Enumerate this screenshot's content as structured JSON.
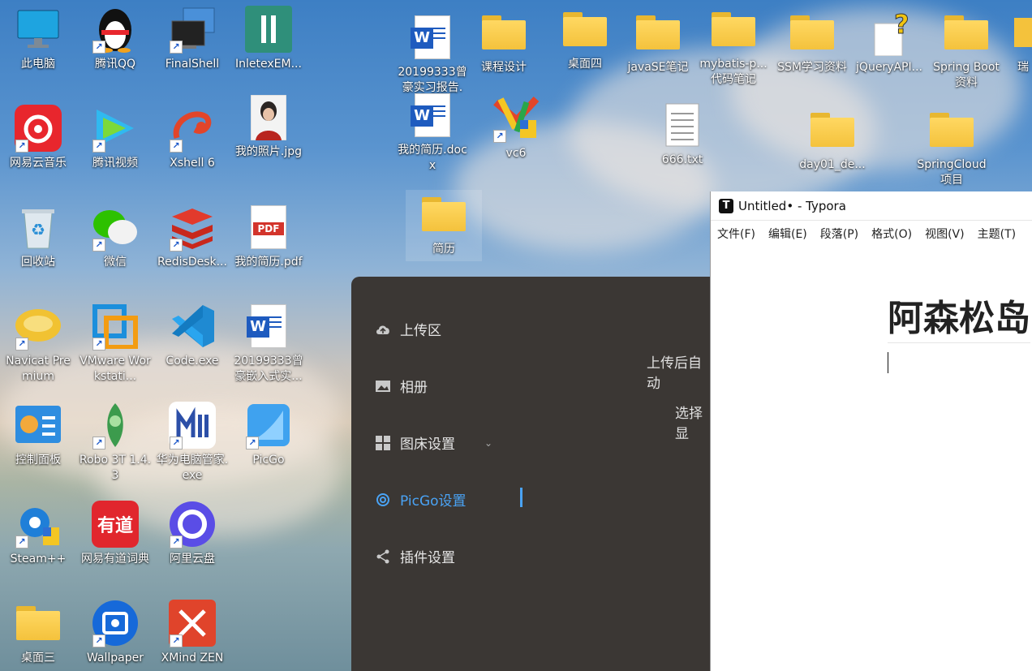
{
  "desktop": {
    "icons": {
      "this_pc": "此电脑",
      "tencent_qq": "腾讯QQ",
      "finalshell": "FinalShell",
      "inletex": "InletexEM...",
      "report_docx": "20199333曾豪实习报告.",
      "course_design": "课程设计",
      "desktop4": "桌面四",
      "javase_notes": "javaSE笔记",
      "mybatis_notes": "mybatis-p... 代码笔记",
      "ssm_notes": "SSM学习资料",
      "jquery_api": "jQueryAPI...",
      "springboot": "Spring Boot 资料",
      "rui": "瑞",
      "netease_music": "网易云音乐",
      "tencent_video": "腾讯视频",
      "xshell": "Xshell 6",
      "my_photo": "我的照片.jpg",
      "my_resume_docx": "我的简历.docx",
      "vc6": "vc6",
      "txt_666": "666.txt",
      "day01": "day01_de...",
      "springcloud": "SpringCloud 项目",
      "recycle_bin": "回收站",
      "wechat": "微信",
      "redis_desk": "RedisDesk...",
      "my_resume_pdf": "我的简历.pdf",
      "resume_folder": "简历",
      "navicat": "Navicat Premium",
      "vmware": "VMware Workstati...",
      "vscode": "Code.exe",
      "embedded_docx": "20199333曾豪嵌入式实...",
      "control_panel": "控制面板",
      "robo3t": "Robo 3T 1.4.3",
      "huawei_pc": "华为电脑管家.exe",
      "picgo": "PicGo",
      "steam": "Steam++",
      "youdao": "网易有道词典",
      "aliyun": "阿里云盘",
      "desktop3": "桌面三",
      "wallpaper": "Wallpaper",
      "xmind": "XMind ZEN"
    },
    "pdf_text": "PDF",
    "word_letter": "W",
    "shortcut_arrow": "↗",
    "youdao_text": "有道"
  },
  "picgo": {
    "menu": {
      "upload": "上传区",
      "album": "相册",
      "bed_settings": "图床设置",
      "picgo_settings": "PicGo设置",
      "plugin_settings": "插件设置"
    },
    "partial_text_1": "上传后自动",
    "partial_text_2": "选择显"
  },
  "typora": {
    "title": "Untitled• - Typora",
    "logo": "T",
    "menu": [
      "文件(F)",
      "编辑(E)",
      "段落(P)",
      "格式(O)",
      "视图(V)",
      "主题(T)"
    ],
    "heading": "阿森松岛"
  },
  "colors": {
    "picgo_bg": "#3b3734",
    "picgo_accent": "#4aa3f5",
    "folder_yellow": "#f4c23c",
    "word_blue": "#1e5bbf"
  }
}
